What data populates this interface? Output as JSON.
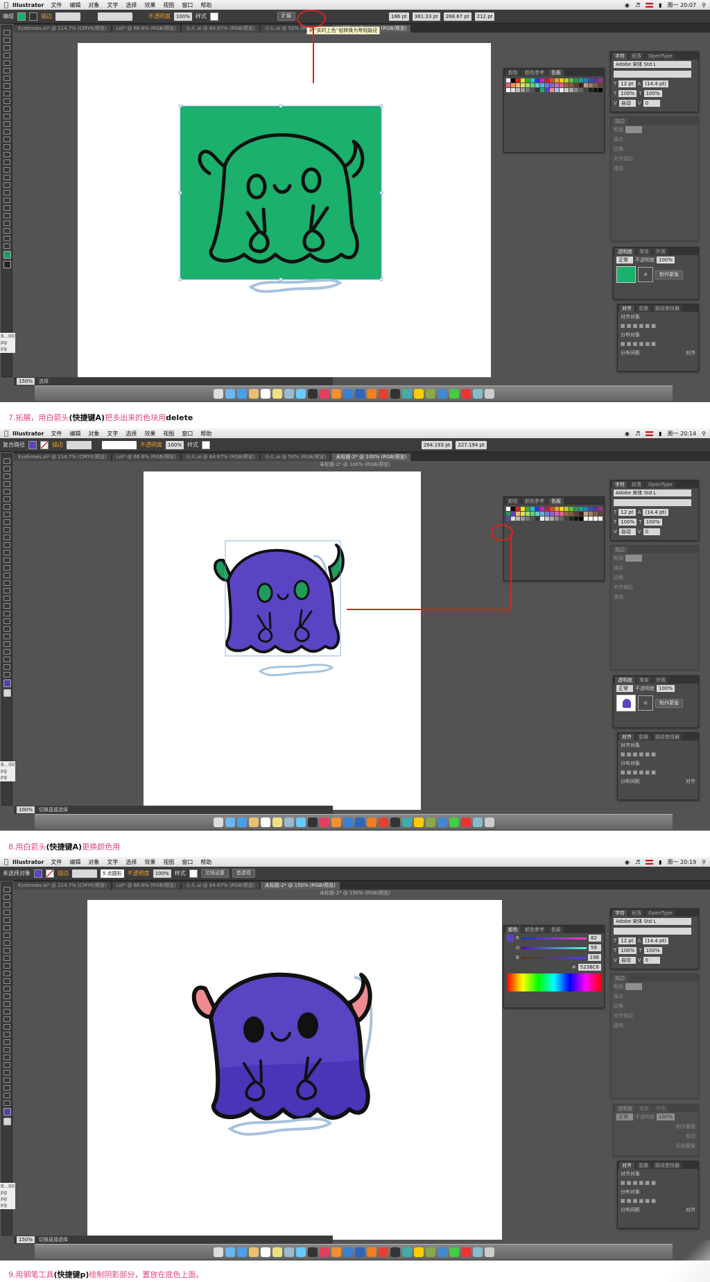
{
  "screens": [
    {
      "menubar": {
        "app": "Illustrator",
        "items": [
          "文件",
          "编辑",
          "对象",
          "文字",
          "选择",
          "效果",
          "视图",
          "窗口",
          "帮助"
        ],
        "clock": "周一 20:07"
      },
      "control": {
        "selection": "编组",
        "stroke_label": "描边",
        "opacity_label": "不透明度",
        "opacity": "100%",
        "style_label": "样式",
        "expand_button": "扩展",
        "w": "186 pt",
        "h": "361.33 pt",
        "x": "268.67 pt",
        "y": "212 pt"
      },
      "tooltip": "将“实时上色”组转换为常规路径",
      "tabs": [
        "Eyebrows.ai* @ 114.7% (CMYK/预览)",
        "Lol* @ 66.6% (RGB/预览)",
        "小人.ai @ 64.67% (RGB/预览)",
        "小人.ai @ 50% (RGB/预览)",
        "未标题-2* @ 100% (RGB/预览)"
      ],
      "status_zoom": "150%",
      "status_mode": "选择"
    },
    {
      "menubar": {
        "app": "Illustrator",
        "items": [
          "文件",
          "编辑",
          "对象",
          "文字",
          "选择",
          "效果",
          "视图",
          "窗口",
          "帮助"
        ],
        "clock": "周一 20:14"
      },
      "control": {
        "selection": "复合路径",
        "stroke_label": "描边",
        "opacity_label": "不透明度",
        "opacity": "100%",
        "style_label": "样式",
        "w": "264.193 pt",
        "h": "227.194 pt"
      },
      "title": "未标题-2* @ 100% (RGB/预览)",
      "tabs": [
        "Eyebrows.ai* @ 114.7% (CMYK/预览)",
        "Lol* @ 66.6% (RGB/预览)",
        "小人.ai @ 64.67% (RGB/预览)",
        "小人.ai @ 50% (RGB/预览)",
        "未标题-2* @ 100% (RGB/预览)"
      ],
      "status_zoom": "100%",
      "status_mode": "切换直接选择"
    },
    {
      "menubar": {
        "app": "Illustrator",
        "items": [
          "文件",
          "编辑",
          "对象",
          "文字",
          "选择",
          "效果",
          "视图",
          "窗口",
          "帮助"
        ],
        "clock": "周一 20:19"
      },
      "control": {
        "selection": "未选择对象",
        "stroke_label": "描边",
        "brush": "5 点圆形",
        "opacity_label": "不透明度",
        "opacity": "100%",
        "style_label": "样式",
        "doc_setup": "文档设置",
        "prefs": "首选项"
      },
      "title": "未标题-2* @ 150% (RGB/预览)",
      "tabs": [
        "Eyebrows.ai* @ 114.7% (CMYK/预览)",
        "Lol* @ 66.6% (RGB/预览)",
        "小人.ai @ 64.67% (RGB/预览)",
        "未标题-2* @ 150% (RGB/预览)"
      ],
      "status_zoom": "150%",
      "status_mode": "切换直接选择",
      "color_panel": {
        "r": "82",
        "g": "59",
        "b": "198",
        "hex": "523BC6"
      }
    }
  ],
  "panels": {
    "swatch_tabs": [
      "颜色",
      "颜色参考",
      "色板"
    ],
    "char_tabs": [
      "字符",
      "段落",
      "OpenType"
    ],
    "font": "Adobe 宋体 Std L",
    "font_size": "12 pt",
    "leading": "(14.4 pt)",
    "scale_h": "100%",
    "scale_v": "100%",
    "tracking": "自动",
    "kerning": "0",
    "stroke_title": "描边",
    "stroke_weight": "粗细",
    "stroke_cap": "端点",
    "stroke_corner": "边角",
    "stroke_align": "对齐描边",
    "dash": "虚线",
    "transparency_tabs": [
      "透明度",
      "渐变",
      "外观"
    ],
    "blend_mode": "正常",
    "opacity_label": "不透明度",
    "opacity": "100%",
    "make_mask": "制作蒙版",
    "clip": "剪切",
    "invert_mask": "反相蒙版",
    "align_tabs": [
      "对齐",
      "变换",
      "路径查找器"
    ],
    "align_objects": "对齐对象",
    "distribute_objects": "分布对象",
    "distribute_spacing": "分布间距",
    "align_to": "对齐"
  },
  "captions": [
    {
      "prefix": "7.拓展，用白箭头",
      "shortcut": "(快捷键A)",
      "rest": "把多出来的色块用",
      "end": "delete"
    },
    {
      "prefix": "8.用白箭头",
      "shortcut": "(快捷键A)",
      "rest": "更换颜色用",
      "end": ""
    },
    {
      "prefix": "9.用钢笔工具",
      "shortcut": "(快捷键p)",
      "rest": "绘制阴影部分，置放在底色上面。",
      "end": ""
    }
  ],
  "left_snips": [
    "8...00",
    "pg",
    "pg",
    "pg"
  ],
  "colors": {
    "green": "#1bb06c",
    "purple": "#5a44c4",
    "purple_dark": "#4a34b8",
    "horn_green": "#1e9c5c",
    "horn_pink": "#ef8a90",
    "outline": "#111111",
    "shadow_blue": "#a7c3dd",
    "red": "#e02020",
    "caption_pink": "#e0477f"
  }
}
